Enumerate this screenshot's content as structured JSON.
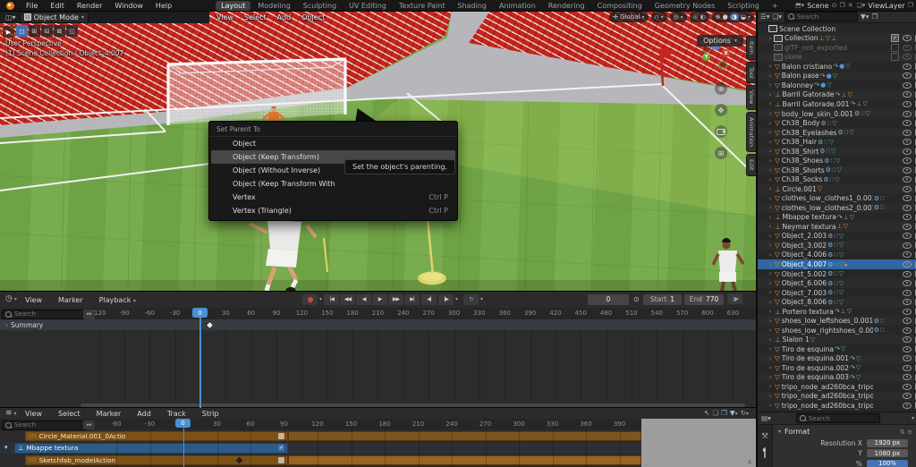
{
  "colors": {
    "accent_blue": "#4772b3",
    "selection_blue": "#3166a0",
    "playhead_blue": "#4a90d2",
    "strip_orange": "#8a5c22",
    "seat_red": "#c4261d",
    "grass_green": "#74a947"
  },
  "topbar": {
    "menus": [
      "File",
      "Edit",
      "Render",
      "Window",
      "Help"
    ],
    "workspaces": [
      "Layout",
      "Modeling",
      "Sculpting",
      "UV Editing",
      "Texture Paint",
      "Shading",
      "Animation",
      "Rendering",
      "Compositing",
      "Geometry Nodes",
      "Scripting"
    ],
    "active_workspace": "Layout",
    "add_workspace": "+",
    "scene_label": "Scene",
    "viewlayer_label": "ViewLayer"
  },
  "viewport": {
    "header": {
      "mode": "Object Mode",
      "menus": [
        "View",
        "Select",
        "Add",
        "Object"
      ],
      "orientation": "Global"
    },
    "options_label": "Options",
    "overlay": {
      "perspective": "User Perspective",
      "context": "(1) Scene Collection | Object_4.007"
    },
    "npanel_tabs": [
      "Item",
      "Tool",
      "View",
      "Animation",
      "Edit"
    ],
    "gizmo_axes": [
      "Z",
      "Y",
      "X"
    ],
    "context_menu": {
      "title": "Set Parent To",
      "items": [
        {
          "label": "Object",
          "shortcut": "",
          "highlighted": false
        },
        {
          "label": "Object (Keep Transform)",
          "shortcut": "",
          "highlighted": true
        },
        {
          "label": "Object (Without Inverse)",
          "shortcut": "",
          "highlighted": false
        },
        {
          "label": "Object (Keep Transform With",
          "shortcut": "",
          "highlighted": false
        },
        {
          "label": "Vertex",
          "shortcut": "Ctrl P",
          "highlighted": false
        },
        {
          "label": "Vertex (Triangle)",
          "shortcut": "Ctrl P",
          "highlighted": false
        }
      ]
    },
    "tooltip": "Set the object's parenting."
  },
  "outliner": {
    "search_placeholder": "Search",
    "rows": [
      {
        "label": "Scene Collection",
        "type": "scene",
        "extras": [],
        "right": "none",
        "chevron": false
      },
      {
        "label": "Collection",
        "type": "collection",
        "extras": [
          "child-empty",
          "child-mesh",
          "child-empty"
        ],
        "right": "check-filled",
        "chevron": true
      },
      {
        "label": "glTF_not_exported",
        "type": "collection",
        "extras": [],
        "grayed": true,
        "right": "check-empty",
        "chevron": false
      },
      {
        "label": "skele",
        "type": "collection",
        "extras": [],
        "grayed": true,
        "right": "check-empty",
        "chevron": false
      },
      {
        "label": "Balon cristiano",
        "type": "mesh",
        "extras": [
          "anim",
          "physics",
          "meshdata"
        ],
        "chevron": true
      },
      {
        "label": "Balon pase",
        "type": "mesh",
        "extras": [
          "anim",
          "physics",
          "meshdata"
        ],
        "chevron": true
      },
      {
        "label": "Balonney",
        "type": "mesh",
        "extras": [
          "anim",
          "physics",
          "meshdata"
        ],
        "chevron": true
      },
      {
        "label": "Barril Gatorade",
        "type": "empty",
        "extras": [
          "anim",
          "child-empty",
          "child-mesh"
        ],
        "chevron": true
      },
      {
        "label": "Barril Gatorade.001",
        "type": "empty",
        "extras": [
          "anim",
          "child-empty",
          "child-mesh"
        ],
        "chevron": true
      },
      {
        "label": "body_low_skin_0.001",
        "type": "mesh",
        "extras": [
          "wrench",
          "modifier",
          "meshdata"
        ],
        "chevron": true
      },
      {
        "label": "Ch38_Body",
        "type": "mesh",
        "extras": [
          "wrench",
          "modifier",
          "meshdata"
        ],
        "chevron": true
      },
      {
        "label": "Ch38_Eyelashes",
        "type": "mesh",
        "extras": [
          "wrench",
          "modifier",
          "meshdata"
        ],
        "chevron": true
      },
      {
        "label": "Ch38_Hair",
        "type": "mesh",
        "extras": [
          "wrench",
          "modifier",
          "meshdata"
        ],
        "chevron": true
      },
      {
        "label": "Ch38_Shirt",
        "type": "mesh",
        "extras": [
          "wrench",
          "modifier",
          "meshdata"
        ],
        "chevron": true
      },
      {
        "label": "Ch38_Shoes",
        "type": "mesh",
        "extras": [
          "wrench",
          "modifier",
          "meshdata"
        ],
        "chevron": true
      },
      {
        "label": "Ch38_Shorts",
        "type": "mesh",
        "extras": [
          "wrench",
          "modifier",
          "meshdata"
        ],
        "chevron": true
      },
      {
        "label": "Ch38_Socks",
        "type": "mesh",
        "extras": [
          "wrench",
          "modifier",
          "meshdata"
        ],
        "chevron": true
      },
      {
        "label": "Circle.001",
        "type": "empty",
        "extras": [
          "child-mesh"
        ],
        "chevron": true
      },
      {
        "label": "clothes_low_clothes1_0.001",
        "type": "mesh",
        "extras": [
          "wrench",
          "modifier"
        ],
        "chevron": true
      },
      {
        "label": "clothes_low_clothes2_0.001",
        "type": "mesh",
        "extras": [
          "wrench",
          "modifier"
        ],
        "chevron": true
      },
      {
        "label": "Mbappe textura",
        "type": "empty",
        "extras": [
          "anim",
          "child-empty",
          "child-mesh"
        ],
        "chevron": true
      },
      {
        "label": "Neymar textura",
        "type": "empty",
        "extras": [
          "child-empty",
          "child-mesh"
        ],
        "chevron": true
      },
      {
        "label": "Object_2.003",
        "type": "mesh",
        "extras": [
          "wrench",
          "modifier",
          "meshdata"
        ],
        "chevron": true
      },
      {
        "label": "Object_3.002",
        "type": "mesh",
        "extras": [
          "wrench",
          "modifier",
          "meshdata"
        ],
        "chevron": true
      },
      {
        "label": "Object_4.006",
        "type": "mesh",
        "extras": [
          "wrench",
          "modifier",
          "meshdata"
        ],
        "chevron": true
      },
      {
        "label": "Object_4.007",
        "type": "mesh",
        "extras": [
          "wrench",
          "modifier",
          "meshdata",
          "action"
        ],
        "selected": true,
        "chevron": true
      },
      {
        "label": "Object_5.002",
        "type": "mesh",
        "extras": [
          "wrench",
          "modifier",
          "meshdata"
        ],
        "chevron": true
      },
      {
        "label": "Object_6.006",
        "type": "mesh",
        "extras": [
          "wrench",
          "modifier",
          "meshdata"
        ],
        "chevron": true
      },
      {
        "label": "Object_7.003",
        "type": "mesh",
        "extras": [
          "wrench",
          "modifier",
          "meshdata"
        ],
        "chevron": true
      },
      {
        "label": "Object_8.006",
        "type": "mesh",
        "extras": [
          "wrench",
          "modifier",
          "meshdata"
        ],
        "chevron": true
      },
      {
        "label": "Portero textura",
        "type": "empty",
        "extras": [
          "anim",
          "child-empty",
          "child-mesh"
        ],
        "chevron": true
      },
      {
        "label": "shoes_low_leftshoes_0.001",
        "type": "mesh",
        "extras": [
          "wrench",
          "modifier"
        ],
        "chevron": true
      },
      {
        "label": "shoes_low_rightshoes_0.001",
        "type": "mesh",
        "extras": [
          "wrench",
          "modifier"
        ],
        "chevron": true
      },
      {
        "label": "Slalon 1",
        "type": "empty",
        "extras": [
          "child-mesh"
        ],
        "chevron": true
      },
      {
        "label": "Tiro de esquina",
        "type": "mesh",
        "extras": [
          "anim",
          "meshdata"
        ],
        "chevron": true
      },
      {
        "label": "Tiro de esquina.001",
        "type": "mesh",
        "extras": [
          "anim",
          "meshdata"
        ],
        "chevron": true
      },
      {
        "label": "Tiro de esquina.002",
        "type": "mesh",
        "extras": [
          "anim",
          "meshdata"
        ],
        "chevron": true
      },
      {
        "label": "Tiro de esquina.003",
        "type": "mesh",
        "extras": [
          "anim",
          "meshdata"
        ],
        "chevron": true
      },
      {
        "label": "tripo_node_ad260bca_tripo_mat_ad26",
        "type": "mesh",
        "extras": [],
        "chevron": true
      },
      {
        "label": "tripo_node_ad260bca_tripo_mat_ad26",
        "type": "mesh",
        "extras": [],
        "chevron": true
      },
      {
        "label": "tripo_node_ad260bca_tripo_mat_ad26",
        "type": "mesh",
        "extras": [],
        "chevron": true
      }
    ]
  },
  "properties": {
    "search_placeholder": "Search",
    "panel_title": "Format",
    "rows": [
      {
        "label": "Resolution X",
        "value": "1920 px",
        "accent": false
      },
      {
        "label": "Y",
        "value": "1080 px",
        "accent": false
      },
      {
        "label": "%",
        "value": "100%",
        "accent": true
      }
    ]
  },
  "timeline": {
    "menus": [
      "View",
      "Marker",
      "Playback"
    ],
    "search_placeholder": "Search",
    "summary_label": "Summary",
    "ticks": [
      -120,
      -90,
      -60,
      -30,
      0,
      30,
      60,
      90,
      120,
      150,
      180,
      210,
      240,
      270,
      300,
      330,
      360,
      390,
      420,
      450,
      480,
      510,
      540,
      570,
      600,
      630
    ],
    "current_frame": "0",
    "frame_value": "0",
    "start_label": "Start",
    "start_value": "1",
    "end_label": "End",
    "end_value": "770",
    "keyframe_frames": [
      10
    ],
    "transport": [
      "jump-to-start",
      "jump-to-prev-keyframe",
      "play-reverse",
      "play",
      "jump-to-next-keyframe",
      "jump-to-end"
    ]
  },
  "nla": {
    "menus": [
      "View",
      "Select",
      "Marker",
      "Add",
      "Track",
      "Strip"
    ],
    "search_placeholder": "Search",
    "ticks": [
      -60,
      -30,
      0,
      30,
      60,
      90,
      120,
      150,
      180,
      210,
      240,
      270,
      300,
      330,
      360,
      390
    ],
    "current_frame": "0",
    "tracks": [
      {
        "name": "Circle_Material.001_0Actio",
        "kind": "action",
        "strip": true,
        "selected": false
      },
      {
        "name": "Mbappe textura",
        "kind": "object",
        "strip": false,
        "selected": true,
        "checked": true
      },
      {
        "name": "Sketchfab_modelAction",
        "kind": "action",
        "strip": true,
        "selected": false
      }
    ]
  }
}
